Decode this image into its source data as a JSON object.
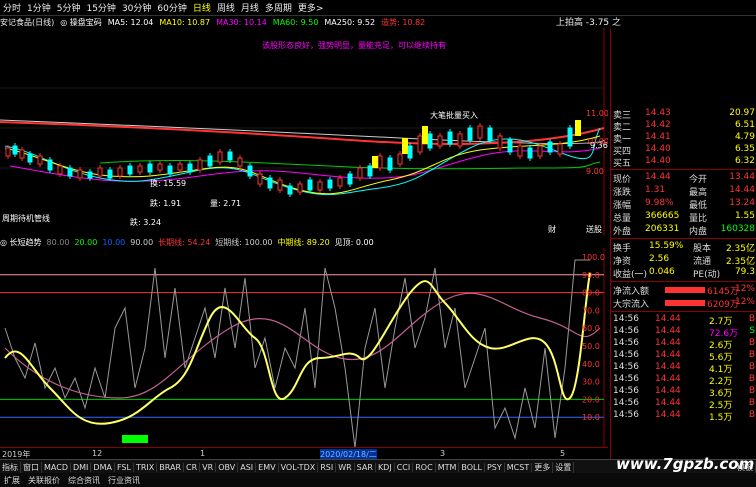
{
  "tabs": [
    "分时",
    "1分钟",
    "5分钟",
    "15分钟",
    "30分钟",
    "60分钟",
    "日线",
    "周线",
    "月线",
    "多周期",
    "更多>"
  ],
  "stock_title": "安记食品(日线)",
  "top_info": [
    {
      "text": "◎ 操盘宝码",
      "color": "#ffffff"
    },
    {
      "text": "MA5: 12.04",
      "color": "#ffffff"
    },
    {
      "text": "MA10: 10.87",
      "color": "#ffff00"
    },
    {
      "text": "MA30: 10.14",
      "color": "#ff00ff"
    },
    {
      "text": "MA60: 9.50",
      "color": "#00ff00"
    },
    {
      "text": "MA250: 9.52",
      "color": "#ffffff"
    },
    {
      "text": "造势: 10.82",
      "color": "#ff3333"
    }
  ],
  "right_title": "上拍高 -3.75 之",
  "price_annotations": [
    {
      "text": "该股形态良好，强势明显，量能充足，可以继续持有",
      "color": "#ff00ff"
    },
    {
      "text": "大笔批量买入",
      "color": "#ffffff"
    },
    {
      "text": "换: 15.59",
      "color": "#ffffff"
    },
    {
      "text": "跌: 1.91",
      "color": "#ffffff"
    },
    {
      "text": "量: 2.71",
      "color": "#ffffff"
    },
    {
      "text": "周期待机管线",
      "color": "#ffffff"
    },
    {
      "text": "跌: 3.24",
      "color": "#ffffff"
    },
    {
      "text": "9.36",
      "color": "#ffffff"
    },
    {
      "text": "财",
      "color": "#ffffff"
    },
    {
      "text": "送股",
      "color": "#ffffff"
    }
  ],
  "price_axis": [
    "11.00",
    "10.00",
    "9.00"
  ],
  "indicator_bar": [
    {
      "text": "◎ 长短趋势",
      "color": "#ffffff"
    },
    {
      "text": "80.00",
      "color": "#888888"
    },
    {
      "text": "20.00",
      "color": "#00ff00"
    },
    {
      "text": "10.00",
      "color": "#0066ff"
    },
    {
      "text": "90.00",
      "color": "#cccccc"
    },
    {
      "text": "长期线: 54.24",
      "color": "#ff3333"
    },
    {
      "text": "短期线: 100.00",
      "color": "#cccccc"
    },
    {
      "text": "中期线: 89.20",
      "color": "#ffff00"
    },
    {
      "text": "见顶: 0.00",
      "color": "#ffffff"
    }
  ],
  "ind_axis": [
    "100.0",
    "90.0",
    "80.0",
    "70.0",
    "60.0",
    "50.0",
    "40.0",
    "30.0",
    "20.0",
    "10.0"
  ],
  "dates": [
    {
      "text": "2019年",
      "color": "#cccccc"
    },
    {
      "text": "12",
      "color": "#cccccc"
    },
    {
      "text": "1",
      "color": "#cccccc"
    },
    {
      "text": "2020/02/18/二",
      "color": "#7fb3ff"
    },
    {
      "text": "3",
      "color": "#cccccc"
    },
    {
      "text": "5",
      "color": "#cccccc"
    }
  ],
  "bottom_buttons": [
    "指标",
    "窗口",
    "MACD",
    "DMI",
    "DMA",
    "FSL",
    "TRIX",
    "BRAR",
    "CR",
    "VR",
    "OBV",
    "ASI",
    "EMV",
    "VOL-TDX",
    "RSI",
    "WR",
    "SAR",
    "KDJ",
    "CCI",
    "ROC",
    "MTM",
    "BOLL",
    "PSY",
    "MCST",
    "更多",
    "设置"
  ],
  "bottom_buttons2": [
    "扩展",
    "关联报价",
    "综合资讯",
    "行业资讯"
  ],
  "bottom_right": "模板",
  "order_book": [
    {
      "label": "卖三",
      "price": "14.43",
      "vol": "20.97"
    },
    {
      "label": "卖二",
      "price": "14.42",
      "vol": "6.51"
    },
    {
      "label": "卖一",
      "price": "14.41",
      "vol": "4.79"
    },
    {
      "label": "买四",
      "price": "14.40",
      "vol": "6.35"
    },
    {
      "label": "买五",
      "price": "14.40",
      "vol": "6.32"
    }
  ],
  "quote_rows": [
    {
      "l1": "现价",
      "v1": "14.44",
      "l2": "今开",
      "v2": "13.44"
    },
    {
      "l1": "涨跌",
      "v1": "1.31",
      "l2": "最高",
      "v2": "14.44"
    },
    {
      "l1": "涨幅",
      "v1": "9.98%",
      "l2": "最低",
      "v2": "13.24"
    },
    {
      "l1": "总量",
      "v1": "366665",
      "l2": "量比",
      "v2": "1.55"
    },
    {
      "l1": "外盘",
      "v1": "206331",
      "l2": "内盘",
      "v2": "160328"
    }
  ],
  "stat_rows": [
    {
      "l1": "换手",
      "v1": "15.59%",
      "l2": "股本",
      "v2": "2.35亿"
    },
    {
      "l1": "净资",
      "v1": "2.56",
      "l2": "流通",
      "v2": "2.35亿"
    },
    {
      "l1": "收益(一)",
      "v1": "0.046",
      "l2": "PE(动)",
      "v2": "79.3"
    }
  ],
  "flow_rows": [
    {
      "label": "净流入额",
      "value": "6145万",
      "pct": "12%"
    },
    {
      "label": "大宗流入",
      "value": "6209万",
      "pct": "12%"
    }
  ],
  "ticks": [
    {
      "time": "14:56",
      "price": "14.44",
      "vol": "2.7万",
      "dir": "B"
    },
    {
      "time": "14:56",
      "price": "14.44",
      "vol": "72.6万",
      "dir": "S"
    },
    {
      "time": "14:56",
      "price": "14.44",
      "vol": "2.6万",
      "dir": "B"
    },
    {
      "time": "14:56",
      "price": "14.44",
      "vol": "5.6万",
      "dir": "B"
    },
    {
      "time": "14:56",
      "price": "14.44",
      "vol": "4.1万",
      "dir": "B"
    },
    {
      "time": "14:56",
      "price": "14.44",
      "vol": "2.2万",
      "dir": "B"
    },
    {
      "time": "14:56",
      "price": "14.44",
      "vol": "3.6万",
      "dir": "B"
    },
    {
      "time": "14:56",
      "price": "14.44",
      "vol": "2.5万",
      "dir": "B"
    },
    {
      "time": "14:56",
      "price": "14.44",
      "vol": "1.5万",
      "dir": "B"
    }
  ],
  "watermark": "www.7gpzb.com",
  "colors": {
    "red": "#ff3333",
    "green": "#00ff00",
    "yellow": "#ffff00",
    "cyan": "#00ffff",
    "magenta": "#ff00ff",
    "blue": "#3399ff"
  }
}
